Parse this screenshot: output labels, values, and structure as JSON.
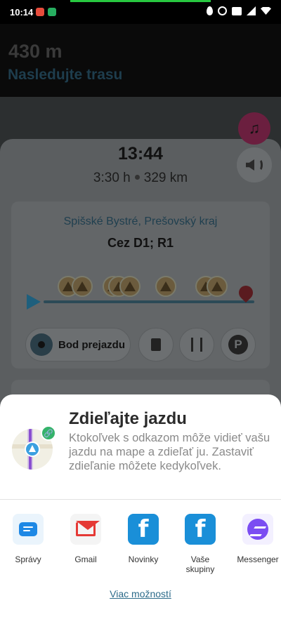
{
  "status_bar": {
    "time": "10:14",
    "icons": [
      "location-icon",
      "alarm-icon",
      "volte-icon",
      "signal-icon",
      "wifi-icon"
    ]
  },
  "navigation": {
    "distance": "430 m",
    "instruction": "Nasledujte trasu"
  },
  "trip": {
    "eta": "13:44",
    "duration": "3:30 h",
    "distance": "329 km",
    "destination_region": "Spišské Bystré, Prešovský kraj",
    "via": "Cez D1; R1",
    "waypoint_label": "Bod prejazdu"
  },
  "share_sheet": {
    "title": "Zdieľajte jazdu",
    "description": "Ktokoľvek s odkazom môže vidieť vašu jazdu na mape a zdieľať ju. Zastaviť zdieľanie môžete kedykoľvek.",
    "apps": [
      {
        "label": "Správy"
      },
      {
        "label": "Gmail"
      },
      {
        "label": "Novinky"
      },
      {
        "label": "Vaše skupiny"
      },
      {
        "label": "Messenger"
      }
    ],
    "more_options": "Viac možností"
  },
  "icons": {
    "facebook_glyph": "f",
    "parking_glyph": "P",
    "link_glyph": "🔗",
    "music_glyph": "♫"
  },
  "colors": {
    "sheet_background": "#ffffff",
    "link_color": "#2c6b8a",
    "facebook_blue": "#1a8fd8",
    "share_badge_green": "#34b36a"
  }
}
